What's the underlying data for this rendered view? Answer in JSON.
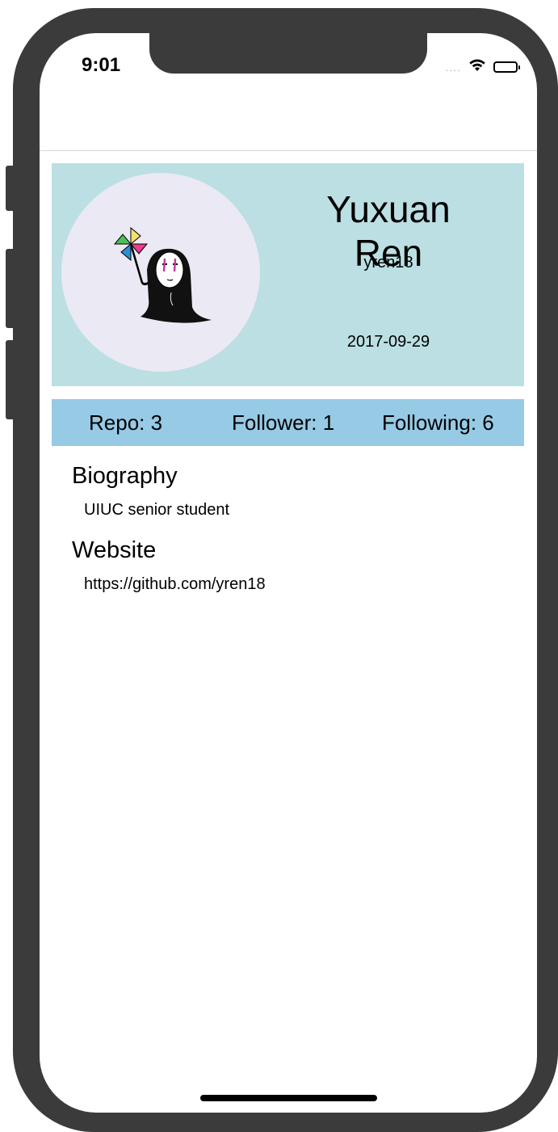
{
  "status_bar": {
    "time": "9:01",
    "signal_dots": "....",
    "icons": [
      "wifi-icon",
      "battery-icon"
    ]
  },
  "profile": {
    "name": "Yuxuan Ren",
    "username": "yren18",
    "join_date": "2017-09-29",
    "avatar_icon": "no-face-pinwheel-avatar"
  },
  "stats": {
    "repo": "Repo: 3",
    "follower": "Follower: 1",
    "following": "Following: 6"
  },
  "biography": {
    "title": "Biography",
    "text": "UIUC senior student"
  },
  "website": {
    "title": "Website",
    "url": "https://github.com/yren18"
  },
  "colors": {
    "profile_card_bg": "#bbdfe3",
    "stats_bar_bg": "#96cae5",
    "avatar_bg": "#ebe9f3"
  }
}
